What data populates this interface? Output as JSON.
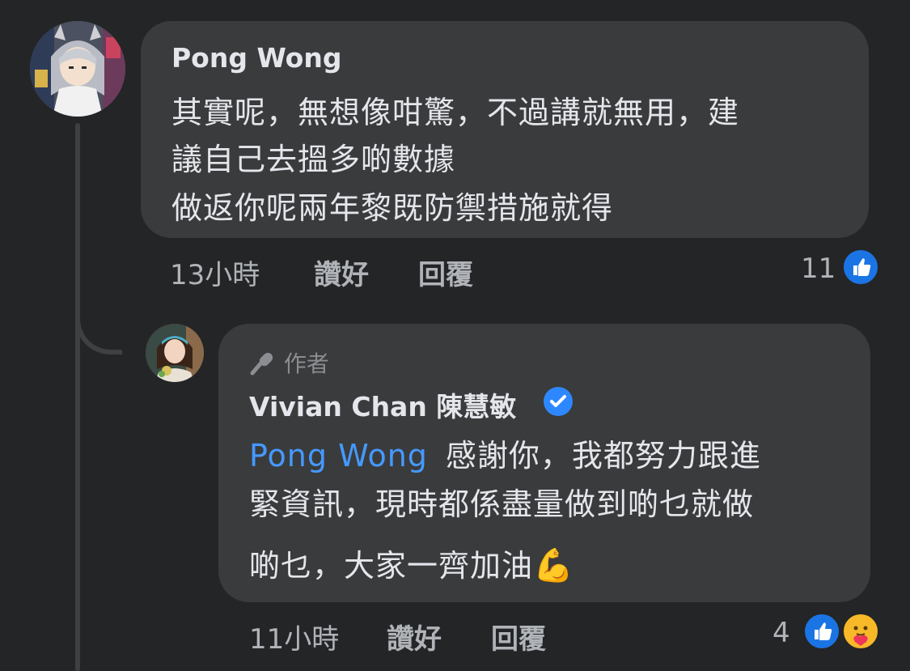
{
  "comment": {
    "author": "Pong Wong",
    "lines": [
      "其實呢，無想像咁驚，不過講就無用，建",
      "議自己去搵多啲數據",
      "做返你呢兩年黎既防禦措施就得"
    ],
    "time": "13小時",
    "like_label": "讚好",
    "reply_label": "回覆",
    "reaction_count": "11"
  },
  "reply": {
    "author_badge": "作者",
    "author": "Vivian Chan 陳慧敏",
    "mention": "Pong Wong",
    "line1_rest": "感謝你，我都努力跟進",
    "line2": "緊資訊，現時都係盡量做到啲乜就做",
    "line3": "啲乜，大家一齊加油",
    "emoji": "💪",
    "time": "11小時",
    "like_label": "讚好",
    "reply_label": "回覆",
    "reaction_count": "4"
  },
  "colors": {
    "background": "#242526",
    "bubble": "#3a3b3c",
    "mention": "#4599ff",
    "like_blue": "#1b74e4",
    "verified_blue": "#2d88ff",
    "secondary_text": "#b0b3b8"
  },
  "icons": [
    "like-reaction-icon",
    "care-reaction-icon",
    "verified-badge-icon",
    "microphone-icon"
  ]
}
